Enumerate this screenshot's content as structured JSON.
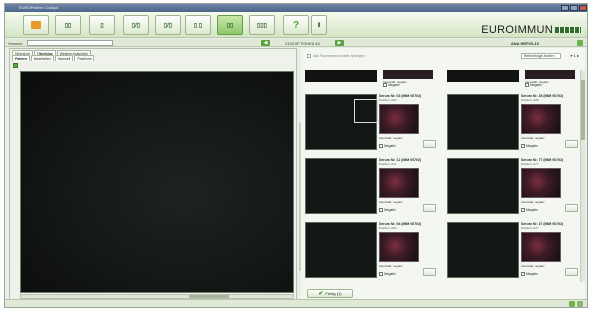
{
  "window": {
    "title": "EUROPattern Cockpit"
  },
  "toolbar": {
    "buttons": [
      {
        "label": ""
      },
      {
        "label": "▯▯ "
      },
      {
        "label": "▯ "
      },
      {
        "label": "▯/▯"
      },
      {
        "label": "▯/▯"
      },
      {
        "label": "▯ ▯"
      },
      {
        "label": "▯▯"
      },
      {
        "label": "▯▯▯"
      },
      {
        "label": "?"
      },
      {
        "label": "Ⅱ"
      }
    ],
    "brand": "EUROIMMUN"
  },
  "nav": {
    "project_label": "Versuch",
    "project_value": "",
    "sample_id": "2103 IIF FGHK5 44",
    "batch": "ANA HEP20-10"
  },
  "left": {
    "tabs_row1": [
      "Übersicht",
      "Titerfolge",
      "Weitere Ansichten"
    ],
    "tabs_row2": [
      "Pattern",
      "Bearbeiten",
      "Manuell",
      "Positions"
    ]
  },
  "right": {
    "show_all_label": "Alle Fluoreszenzmuster anzeigen",
    "sort_dropdown": "Reihenfolge ändern",
    "page_indicator": "1",
    "tiles": [
      {
        "title": "Serum Nr. 03 (IMM 00702)",
        "sub": "Position: A03",
        "result": "Intensität: negativ",
        "negative": "Negativ"
      },
      {
        "title": "Serum Nr. 28 (IMM 00702)",
        "sub": "Position: A28",
        "result": "Intensität: negativ",
        "negative": "Negativ"
      },
      {
        "title": "Serum Nr. 11 (IMM 00702)",
        "sub": "Position: A11",
        "result": "Intensität: negativ",
        "negative": "Negativ"
      },
      {
        "title": "Serum Nr. 77 (IMM 00702)",
        "sub": "Position: A77",
        "result": "Intensität: negativ",
        "negative": "Negativ"
      },
      {
        "title": "Serum Nr. 54 (IMM 00702)",
        "sub": "Position: A54",
        "result": "Intensität: negativ",
        "negative": "Negativ"
      },
      {
        "title": "Serum Nr. 37 (IMM 00702)",
        "sub": "Position: A37",
        "result": "Intensität: negativ",
        "negative": "Negativ"
      }
    ],
    "top_strip": [
      {
        "result": "Intensität: negativ",
        "negative": "Negativ"
      },
      {
        "result": "Intensität: negativ",
        "negative": "Negativ"
      }
    ],
    "ok_label": "Fertig (1)"
  }
}
